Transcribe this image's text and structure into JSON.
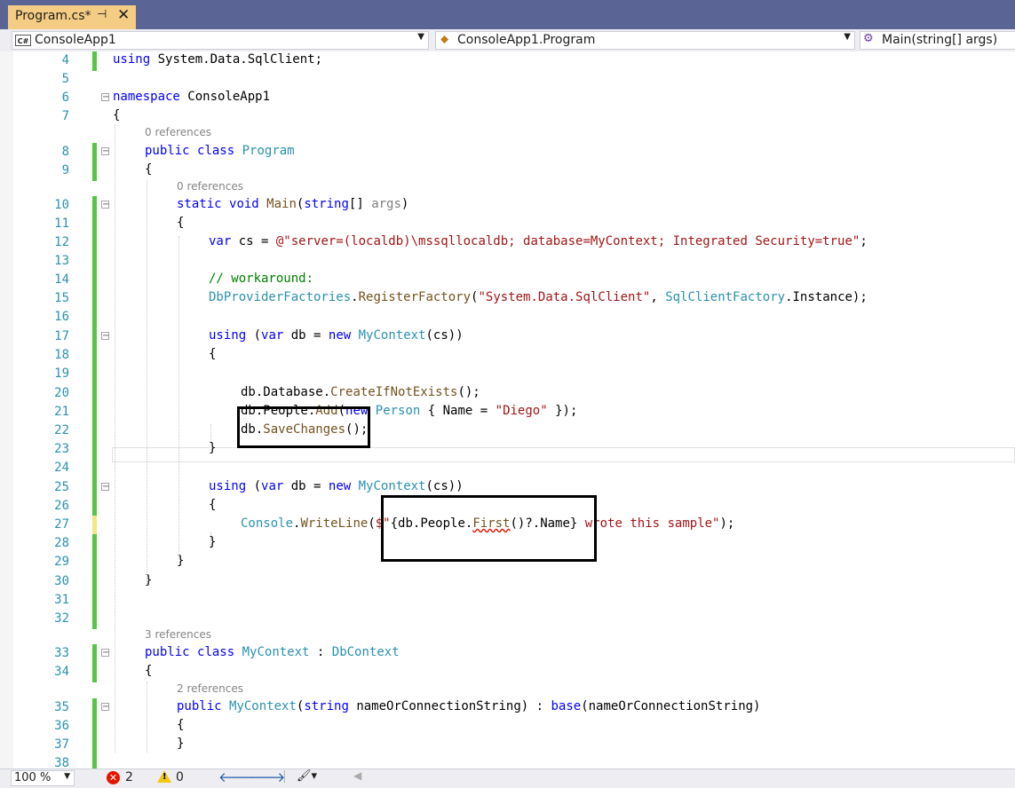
{
  "tab": {
    "title": "Program.cs*",
    "pin_icon": "pin-icon",
    "close_icon": "close-icon"
  },
  "navbar": {
    "project": "ConsoleApp1",
    "project_badge": "C#",
    "type": "ConsoleApp1.Program",
    "member": "Main(string[] args)"
  },
  "editor": {
    "lines": [
      {
        "num": "4",
        "tokens": [
          {
            "t": "using",
            "c": "kw"
          },
          {
            "t": " System.Data.SqlClient;",
            "c": ""
          }
        ]
      },
      {
        "num": "5",
        "tokens": []
      },
      {
        "num": "6",
        "tokens": [
          {
            "t": "namespace",
            "c": "kw"
          },
          {
            "t": " ConsoleApp1",
            "c": ""
          }
        ]
      },
      {
        "num": "7",
        "tokens": [
          {
            "t": "{",
            "c": ""
          }
        ]
      },
      {
        "num": "8",
        "tokens": [
          {
            "t": "public",
            "c": "kw"
          },
          {
            "t": " ",
            "c": ""
          },
          {
            "t": "class",
            "c": "kw"
          },
          {
            "t": " ",
            "c": ""
          },
          {
            "t": "Program",
            "c": "ty"
          }
        ]
      },
      {
        "num": "9",
        "tokens": [
          {
            "t": "{",
            "c": ""
          }
        ]
      },
      {
        "num": "10",
        "tokens": [
          {
            "t": "static",
            "c": "kw"
          },
          {
            "t": " ",
            "c": ""
          },
          {
            "t": "void",
            "c": "kw"
          },
          {
            "t": " ",
            "c": ""
          },
          {
            "t": "Main",
            "c": "me"
          },
          {
            "t": "(",
            "c": ""
          },
          {
            "t": "string",
            "c": "kw"
          },
          {
            "t": "[] ",
            "c": ""
          },
          {
            "t": "args",
            "c": "pa"
          },
          {
            "t": ")",
            "c": ""
          }
        ]
      },
      {
        "num": "11",
        "tokens": [
          {
            "t": "{",
            "c": ""
          }
        ]
      },
      {
        "num": "12",
        "tokens": [
          {
            "t": "var",
            "c": "kw"
          },
          {
            "t": " cs = ",
            "c": ""
          },
          {
            "t": "@\"server=(localdb)\\mssqllocaldb; database=MyContext; Integrated Security=true\"",
            "c": "str"
          },
          {
            "t": ";",
            "c": ""
          }
        ]
      },
      {
        "num": "13",
        "tokens": []
      },
      {
        "num": "14",
        "tokens": [
          {
            "t": "// workaround:",
            "c": "com"
          }
        ]
      },
      {
        "num": "15",
        "tokens": [
          {
            "t": "DbProviderFactories",
            "c": "ty"
          },
          {
            "t": ".",
            "c": ""
          },
          {
            "t": "RegisterFactory",
            "c": "me"
          },
          {
            "t": "(",
            "c": ""
          },
          {
            "t": "\"System.Data.SqlClient\"",
            "c": "str"
          },
          {
            "t": ", ",
            "c": ""
          },
          {
            "t": "SqlClientFactory",
            "c": "ty"
          },
          {
            "t": ".Instance);",
            "c": ""
          }
        ]
      },
      {
        "num": "16",
        "tokens": []
      },
      {
        "num": "17",
        "tokens": [
          {
            "t": "using",
            "c": "kw"
          },
          {
            "t": " (",
            "c": ""
          },
          {
            "t": "var",
            "c": "kw"
          },
          {
            "t": " db = ",
            "c": ""
          },
          {
            "t": "new",
            "c": "kw"
          },
          {
            "t": " ",
            "c": ""
          },
          {
            "t": "MyContext",
            "c": "ty"
          },
          {
            "t": "(cs))",
            "c": ""
          }
        ]
      },
      {
        "num": "18",
        "tokens": [
          {
            "t": "{",
            "c": ""
          }
        ]
      },
      {
        "num": "19",
        "tokens": []
      },
      {
        "num": "20",
        "tokens": [
          {
            "t": "db.Database.",
            "c": ""
          },
          {
            "t": "CreateIfNotExists",
            "c": "me"
          },
          {
            "t": "();",
            "c": ""
          }
        ]
      },
      {
        "num": "21",
        "tokens": [
          {
            "t": "db.People.",
            "c": ""
          },
          {
            "t": "Add",
            "c": "me"
          },
          {
            "t": "(",
            "c": ""
          },
          {
            "t": "new",
            "c": "kw"
          },
          {
            "t": " ",
            "c": ""
          },
          {
            "t": "Person",
            "c": "ty"
          },
          {
            "t": " { Name = ",
            "c": ""
          },
          {
            "t": "\"Diego\"",
            "c": "str"
          },
          {
            "t": " });",
            "c": ""
          }
        ]
      },
      {
        "num": "22",
        "tokens": [
          {
            "t": "db.",
            "c": ""
          },
          {
            "t": "SaveChanges",
            "c": "me"
          },
          {
            "t": "();",
            "c": ""
          }
        ]
      },
      {
        "num": "23",
        "tokens": [
          {
            "t": "}",
            "c": ""
          }
        ]
      },
      {
        "num": "24",
        "tokens": []
      },
      {
        "num": "25",
        "tokens": [
          {
            "t": "using",
            "c": "kw"
          },
          {
            "t": " (",
            "c": ""
          },
          {
            "t": "var",
            "c": "kw"
          },
          {
            "t": " db = ",
            "c": ""
          },
          {
            "t": "new",
            "c": "kw"
          },
          {
            "t": " ",
            "c": ""
          },
          {
            "t": "MyContext",
            "c": "ty"
          },
          {
            "t": "(cs))",
            "c": ""
          }
        ]
      },
      {
        "num": "26",
        "tokens": [
          {
            "t": "{",
            "c": ""
          }
        ]
      },
      {
        "num": "27",
        "tokens": [
          {
            "t": "Console",
            "c": "ty"
          },
          {
            "t": ".",
            "c": ""
          },
          {
            "t": "WriteLine",
            "c": "me"
          },
          {
            "t": "(",
            "c": ""
          },
          {
            "t": "$\"",
            "c": "str"
          },
          {
            "t": "{db.People.",
            "c": ""
          },
          {
            "t": "First",
            "c": "me sq"
          },
          {
            "t": "()?.Name}",
            "c": ""
          },
          {
            "t": " wrote this sample\"",
            "c": "str"
          },
          {
            "t": ");",
            "c": ""
          }
        ]
      },
      {
        "num": "28",
        "tokens": [
          {
            "t": "}",
            "c": ""
          }
        ]
      },
      {
        "num": "29",
        "tokens": [
          {
            "t": "}",
            "c": ""
          }
        ]
      },
      {
        "num": "30",
        "tokens": [
          {
            "t": "}",
            "c": ""
          }
        ]
      },
      {
        "num": "31",
        "tokens": []
      },
      {
        "num": "32",
        "tokens": []
      },
      {
        "num": "33",
        "tokens": [
          {
            "t": "public",
            "c": "kw"
          },
          {
            "t": " ",
            "c": ""
          },
          {
            "t": "class",
            "c": "kw"
          },
          {
            "t": " ",
            "c": ""
          },
          {
            "t": "MyContext",
            "c": "ty"
          },
          {
            "t": " : ",
            "c": ""
          },
          {
            "t": "DbContext",
            "c": "ty"
          }
        ]
      },
      {
        "num": "34",
        "tokens": [
          {
            "t": "{",
            "c": ""
          }
        ]
      },
      {
        "num": "35",
        "tokens": [
          {
            "t": "public",
            "c": "kw"
          },
          {
            "t": " ",
            "c": ""
          },
          {
            "t": "MyContext",
            "c": "ty"
          },
          {
            "t": "(",
            "c": ""
          },
          {
            "t": "string",
            "c": "kw"
          },
          {
            "t": " nameOrConnectionString) : ",
            "c": ""
          },
          {
            "t": "base",
            "c": "kw"
          },
          {
            "t": "(nameOrConnectionString)",
            "c": ""
          }
        ]
      },
      {
        "num": "36",
        "tokens": [
          {
            "t": "{",
            "c": ""
          }
        ]
      },
      {
        "num": "37",
        "tokens": [
          {
            "t": "}",
            "c": ""
          }
        ]
      },
      {
        "num": "38",
        "tokens": []
      }
    ],
    "references": [
      {
        "text": "0 references",
        "before_line": "8"
      },
      {
        "text": "0 references",
        "before_line": "10"
      },
      {
        "text": "3 references",
        "before_line": "33"
      },
      {
        "text": "2 references",
        "before_line": "35"
      }
    ]
  },
  "status": {
    "zoom": "100 %",
    "errors": "2",
    "warnings": "0"
  },
  "colors": {
    "keyword": "#0000ff",
    "type": "#2b91af",
    "string": "#a31515",
    "comment": "#008000",
    "method": "#74531f",
    "change_saved": "#57c546",
    "change_unsaved": "#f4e77f"
  }
}
